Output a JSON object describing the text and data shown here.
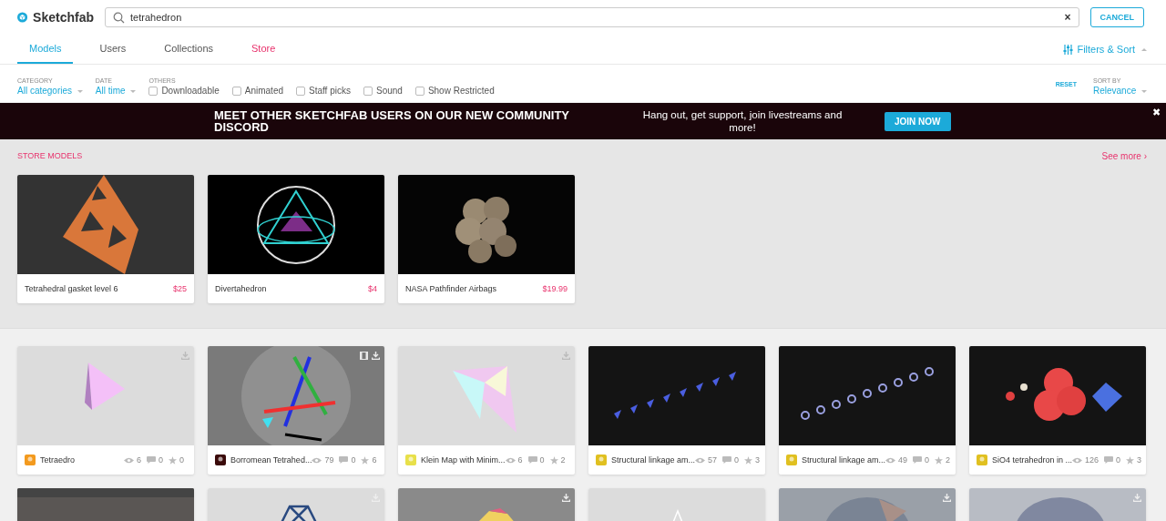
{
  "header": {
    "logo": "Sketchfab",
    "search": {
      "value": "tetrahedron"
    },
    "clear": "×",
    "cancel": "CANCEL"
  },
  "tabs": [
    {
      "label": "Models",
      "selected": true,
      "kind": "section"
    },
    {
      "label": "Users",
      "selected": false,
      "kind": "section"
    },
    {
      "label": "Collections",
      "selected": false,
      "kind": "section"
    },
    {
      "label": "Store",
      "selected": false,
      "kind": "store"
    }
  ],
  "filters_toggle": {
    "label": "Filters & Sort",
    "expanded": true
  },
  "filters": {
    "dropdowns": [
      {
        "caption": "CATEGORY",
        "value": "All categories"
      },
      {
        "caption": "DATE",
        "value": "All time"
      }
    ],
    "others_caption": "OTHERS",
    "checkboxes": [
      {
        "label": "Downloadable",
        "checked": false
      },
      {
        "label": "Animated",
        "checked": false
      },
      {
        "label": "Staff picks",
        "checked": false
      },
      {
        "label": "Sound",
        "checked": false
      },
      {
        "label": "Show Restricted",
        "checked": false
      }
    ],
    "reset": "RESET",
    "sort": {
      "caption": "SORT BY",
      "value": "Relevance"
    }
  },
  "banner": {
    "title": "MEET OTHER SKETCHFAB USERS ON OUR NEW COMMUNITY DISCORD",
    "text": "Hang out, get support, join livestreams and more!",
    "button": "JOIN NOW",
    "close": "✖"
  },
  "store": {
    "heading": "STORE MODELS",
    "see_more": "See more ›",
    "items": [
      {
        "title": "Tetrahedral gasket level 6",
        "price": "$25"
      },
      {
        "title": "Divertahedron",
        "price": "$4"
      },
      {
        "title": "NASA Pathfinder Airbags",
        "price": "$19.99"
      }
    ]
  },
  "models": [
    {
      "title": "Tetraedro",
      "views": "6",
      "comments": "0",
      "likes": "0",
      "download": true,
      "animated": false
    },
    {
      "title": "Borromean Tetrahed...",
      "views": "79",
      "comments": "0",
      "likes": "6",
      "download": true,
      "animated": true
    },
    {
      "title": "Klein Map with Minim...",
      "views": "6",
      "comments": "0",
      "likes": "2",
      "download": true,
      "animated": false
    },
    {
      "title": "Structural linkage am...",
      "views": "57",
      "comments": "0",
      "likes": "3",
      "download": false,
      "animated": false
    },
    {
      "title": "Structural linkage am...",
      "views": "49",
      "comments": "0",
      "likes": "2",
      "download": false,
      "animated": false
    },
    {
      "title": "SiO4 tetrahedron in ...",
      "views": "126",
      "comments": "0",
      "likes": "3",
      "download": false,
      "animated": false
    }
  ],
  "models_next_row": [
    {
      "download": false
    },
    {
      "download": true
    },
    {
      "download": true
    },
    {
      "download": false
    },
    {
      "download": true
    },
    {
      "download": true
    }
  ]
}
